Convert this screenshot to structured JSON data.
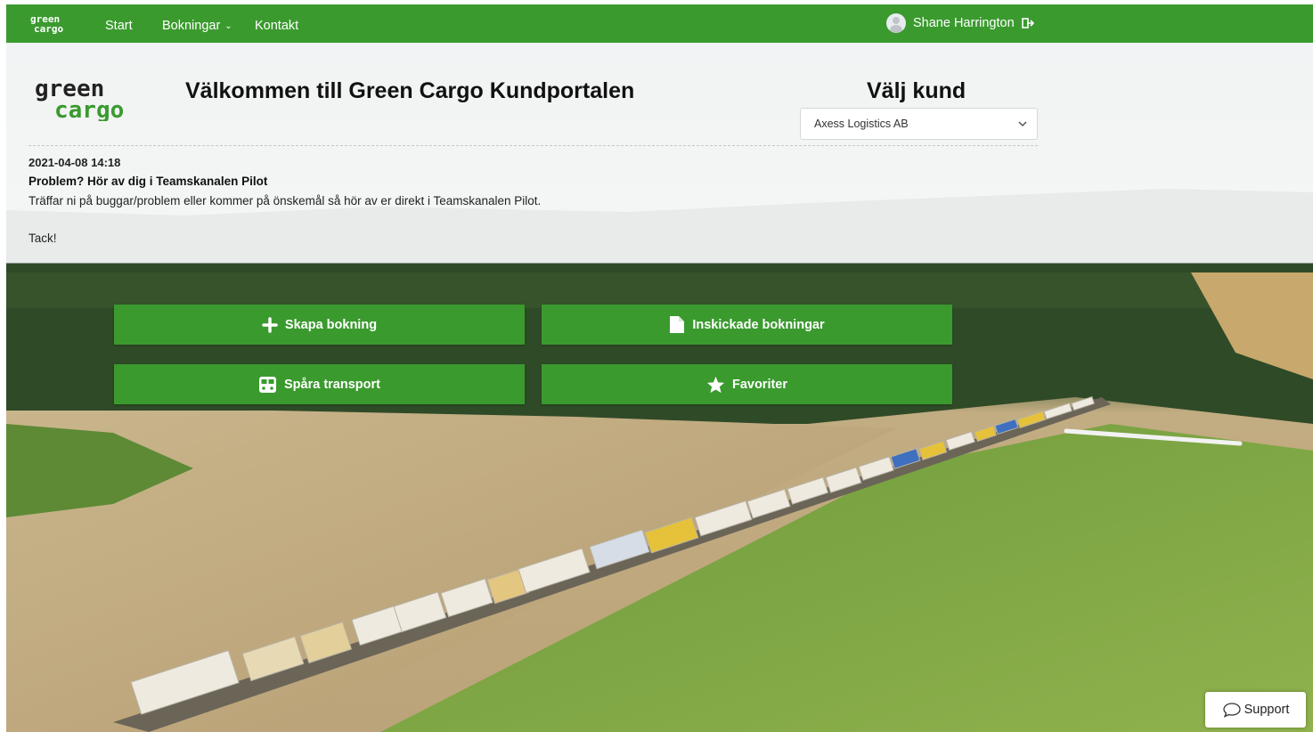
{
  "nav": {
    "logo_text_top": "green",
    "logo_text_bottom": "cargo",
    "start": "Start",
    "bokningar": "Bokningar",
    "kontakt": "Kontakt",
    "user_name": "Shane Harrington"
  },
  "header": {
    "brand_top": "green",
    "brand_bottom": "cargo",
    "welcome": "Välkommen till Green Cargo Kundportalen",
    "choose_customer": "Välj kund",
    "selected_customer": "Axess Logistics AB"
  },
  "news": {
    "date": "2021-04-08 14:18",
    "title": "Problem? Hör av dig i Teamskanalen Pilot",
    "body": "Träffar ni på buggar/problem eller kommer på önskemål så hör av er direkt i Teamskanalen Pilot.",
    "thanks": "Tack!"
  },
  "actions": {
    "create_booking": "Skapa bokning",
    "submitted_bookings": "Inskickade bokningar",
    "track_transport": "Spåra transport",
    "favorites": "Favoriter"
  },
  "support": {
    "label": "Support"
  },
  "colors": {
    "brand_green": "#3a9a2e",
    "logo_dark": "#222222",
    "logo_green": "#3a9a2e"
  },
  "icons": [
    "plus-icon",
    "file-icon",
    "train-icon",
    "star-icon",
    "user-avatar-icon",
    "logout-icon",
    "chevron-down-icon",
    "chat-bubble-icon"
  ]
}
